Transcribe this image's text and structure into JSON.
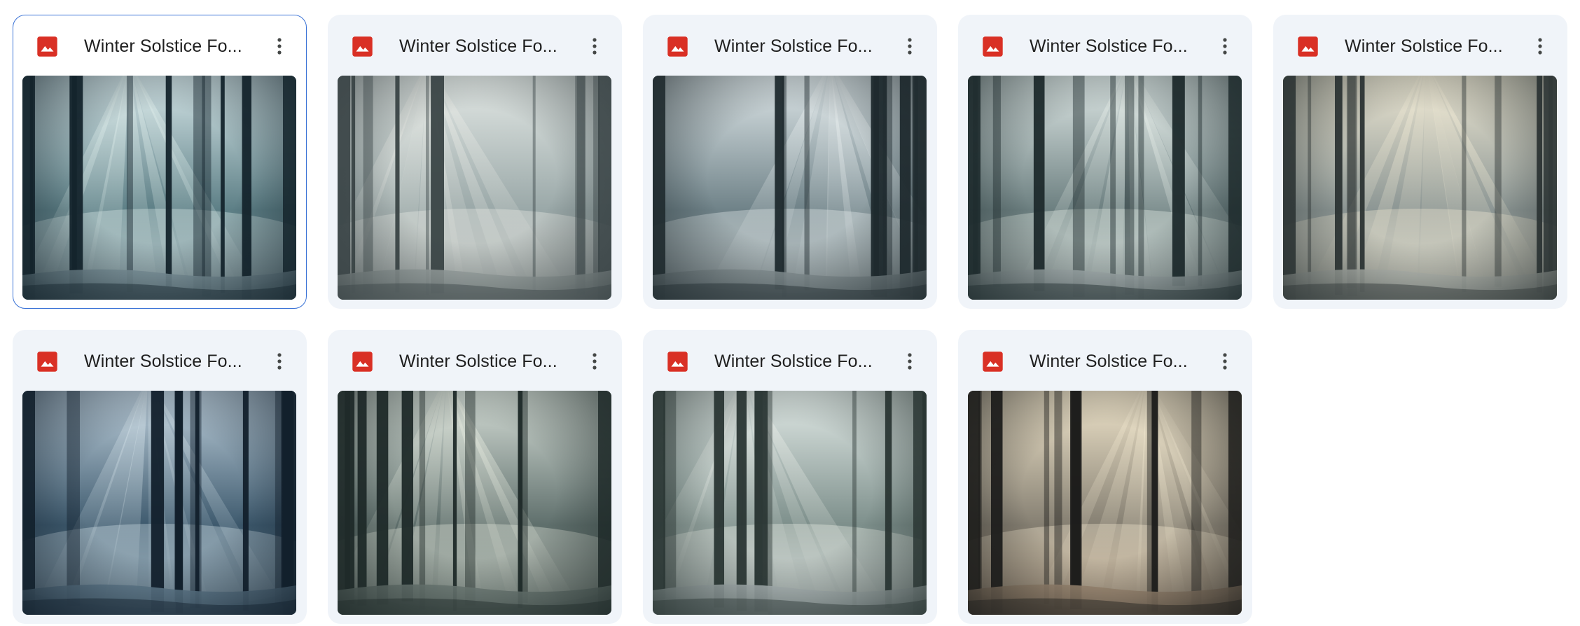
{
  "files": [
    {
      "name": "Winter Solstice Fo...",
      "selected": true,
      "icon": "image-file-icon",
      "palette": {
        "sky": "#d6e6e8",
        "mid": "#5d7f86",
        "dark": "#14242c",
        "ray": "#e3f1ee",
        "ground": "#8ea4ac"
      }
    },
    {
      "name": "Winter Solstice Fo...",
      "selected": false,
      "icon": "image-file-icon",
      "palette": {
        "sky": "#e4e9e6",
        "mid": "#9aa8a8",
        "dark": "#3a4446",
        "ray": "#f2f2ec",
        "ground": "#a9b0ae"
      }
    },
    {
      "name": "Winter Solstice Fo...",
      "selected": false,
      "icon": "image-file-icon",
      "palette": {
        "sky": "#dfe7e9",
        "mid": "#6f8288",
        "dark": "#1f2a2e",
        "ray": "#eef3f3",
        "ground": "#98a3a5"
      }
    },
    {
      "name": "Winter Solstice Fo...",
      "selected": false,
      "icon": "image-file-icon",
      "palette": {
        "sky": "#dfe8e6",
        "mid": "#6c7f80",
        "dark": "#1d2a2c",
        "ray": "#eff5ef",
        "ground": "#b8c1c1"
      }
    },
    {
      "name": "Winter Solstice Fo...",
      "selected": false,
      "icon": "image-file-icon",
      "palette": {
        "sky": "#ece6d2",
        "mid": "#8c9694",
        "dark": "#2c3434",
        "ray": "#f5eed8",
        "ground": "#c7cac2"
      }
    },
    {
      "name": "Winter Solstice Fo...",
      "selected": false,
      "icon": "image-file-icon",
      "palette": {
        "sky": "#bfd0dc",
        "mid": "#3e5a6e",
        "dark": "#12202c",
        "ray": "#dbe8ee",
        "ground": "#6c8799"
      }
    },
    {
      "name": "Winter Solstice Fo...",
      "selected": false,
      "icon": "image-file-icon",
      "palette": {
        "sky": "#d7dfd8",
        "mid": "#5f6f6c",
        "dark": "#1f2a29",
        "ray": "#eaeee2",
        "ground": "#7c8a84"
      }
    },
    {
      "name": "Winter Solstice Fo...",
      "selected": false,
      "icon": "image-file-icon",
      "palette": {
        "sky": "#e3ebe8",
        "mid": "#7d8f8b",
        "dark": "#2a3634",
        "ray": "#f3f5ef",
        "ground": "#bcc5c6"
      }
    },
    {
      "name": "Winter Solstice Fo...",
      "selected": false,
      "icon": "image-file-icon",
      "palette": {
        "sky": "#f1e6cc",
        "mid": "#857f72",
        "dark": "#1e1e1c",
        "ray": "#fbf1d8",
        "ground": "#b39b82"
      }
    }
  ],
  "colors": {
    "card_bg": "#f0f4f9",
    "selected_border": "#3b73d6",
    "icon_red": "#d93025",
    "title_text": "#1f1f1f",
    "more_icon": "#444746"
  }
}
